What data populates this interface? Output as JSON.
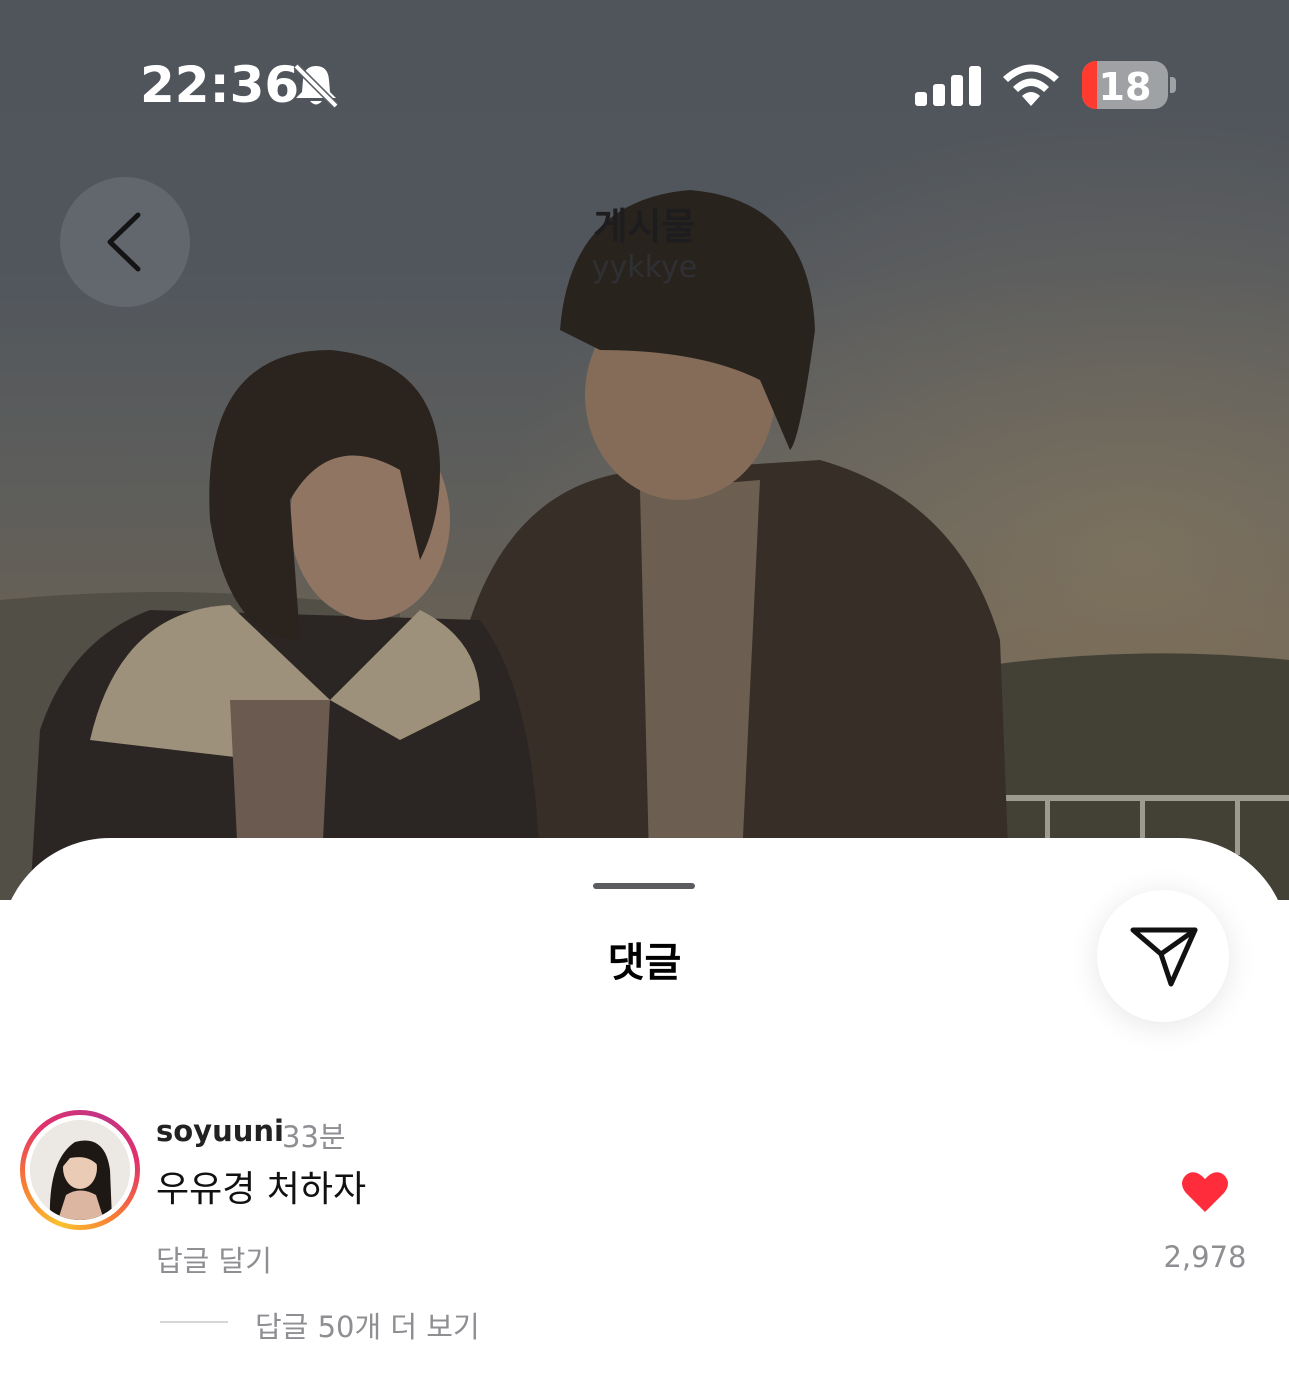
{
  "status_bar": {
    "time": "22:36",
    "battery_level": "18",
    "battery_color": "#ff3b30",
    "icons": [
      "bell-slash-icon",
      "cellular-signal-icon",
      "wifi-icon",
      "battery-icon"
    ]
  },
  "header": {
    "title": "게시물",
    "username": "yykkye",
    "back_icon": "chevron-left-icon"
  },
  "sheet": {
    "title": "댓글",
    "share_icon": "paper-plane-icon"
  },
  "comment": {
    "username": "soyuuni",
    "time_ago": "33분",
    "text": "우유경 처하자",
    "reply_label": "답글 달기",
    "likes": "2,978",
    "like_color": "#ff2d3b",
    "view_replies": "답글 50개 더 보기"
  }
}
